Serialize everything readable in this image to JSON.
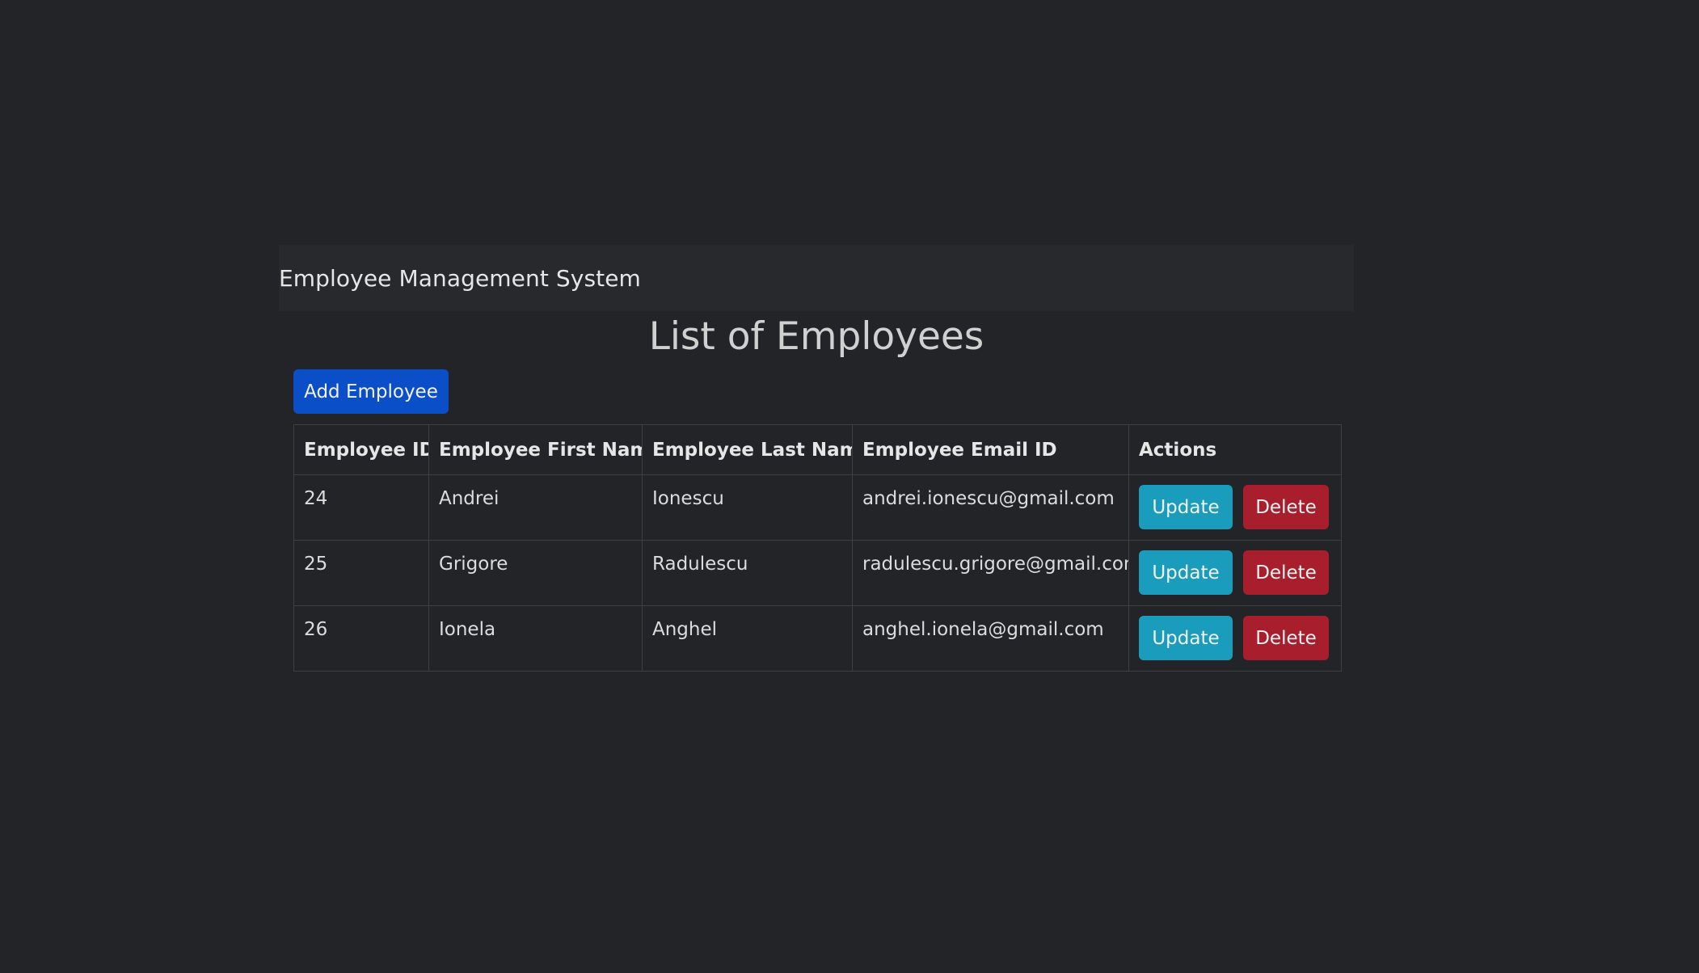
{
  "app": {
    "brand": "Employee Management System"
  },
  "page": {
    "title": "List of Employees",
    "add_button_label": "Add Employee"
  },
  "table": {
    "headers": [
      "Employee ID",
      "Employee First Name",
      "Employee Last Name",
      "Employee Email ID",
      "Actions"
    ],
    "rows": [
      {
        "id": "24",
        "first_name": "Andrei",
        "last_name": "Ionescu",
        "email": "andrei.ionescu@gmail.com"
      },
      {
        "id": "25",
        "first_name": "Grigore",
        "last_name": "Radulescu",
        "email": "radulescu.grigore@gmail.com"
      },
      {
        "id": "26",
        "first_name": "Ionela",
        "last_name": "Anghel",
        "email": "anghel.ionela@gmail.com"
      }
    ],
    "update_label": "Update",
    "delete_label": "Delete"
  },
  "colors": {
    "background": "#232427",
    "navbar": "#28292d",
    "primary": "#0b4fc8",
    "info": "#1a9cbc",
    "danger": "#a81e2d"
  }
}
